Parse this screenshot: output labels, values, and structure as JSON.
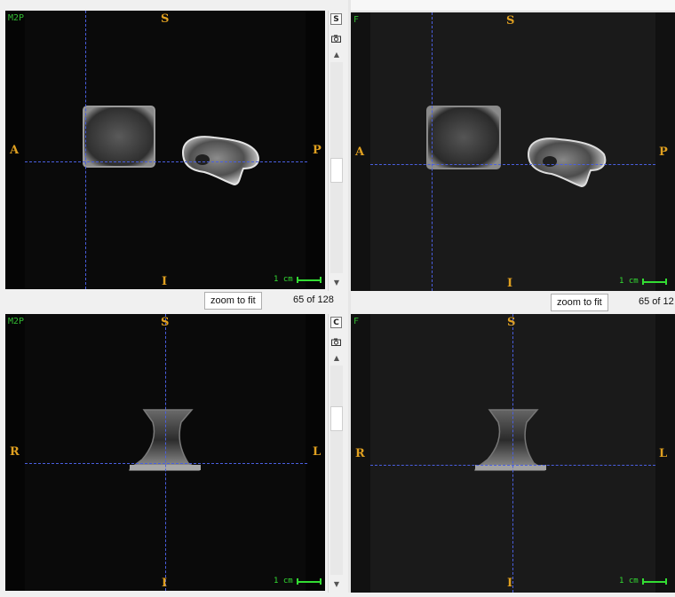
{
  "views": {
    "top_left": {
      "tag": "M2P",
      "orient": {
        "top": "S",
        "bottom": "I",
        "left": "A",
        "right": "P"
      },
      "scale_label": "1 cm",
      "side_button": "S",
      "zoom_label": "zoom to fit",
      "slice_text": "65 of 128"
    },
    "top_right": {
      "tag": "F",
      "orient": {
        "top": "S",
        "bottom": "I",
        "left": "A",
        "right": "P"
      },
      "scale_label": "1 cm",
      "zoom_label": "zoom to fit",
      "slice_text": "65 of 12"
    },
    "bottom_left": {
      "tag": "M2P",
      "orient": {
        "top": "S",
        "bottom": "I",
        "left": "R",
        "right": "L"
      },
      "scale_label": "1 cm",
      "side_button": "C"
    },
    "bottom_right": {
      "tag": "F",
      "orient": {
        "top": "S",
        "bottom": "I",
        "left": "R",
        "right": "L"
      },
      "scale_label": "1 cm"
    }
  },
  "colors": {
    "crosshair": "#4a5fe0",
    "orientation_text": "#e0a020",
    "scale": "#33dd33",
    "tag": "#33bb33"
  },
  "icons": [
    "camera-icon",
    "scroll-up-icon",
    "scroll-down-icon"
  ]
}
